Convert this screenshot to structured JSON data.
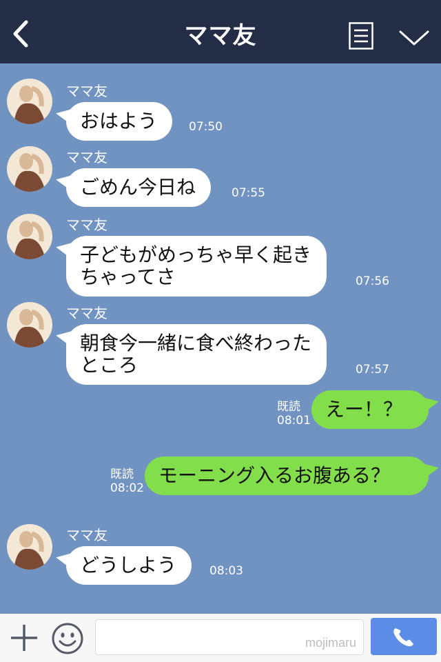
{
  "header": {
    "title": "ママ友",
    "back_icon": "chevron-left-icon",
    "menu_icon": "list-icon",
    "collapse_icon": "chevron-down-icon"
  },
  "messages": [
    {
      "sender": "ママ友",
      "text": "おはよう",
      "time": "07:50"
    },
    {
      "sender": "ママ友",
      "text": "ごめん今日ね",
      "time": "07:55"
    },
    {
      "sender": "ママ友",
      "line1": "子どもがめっちゃ早く起き",
      "line2": "ちゃってさ",
      "time": "07:56"
    },
    {
      "sender": "ママ友",
      "line1": "朝食今一緒に食べ終わった",
      "line2": "ところ",
      "time": "07:57"
    },
    {
      "read": "既読",
      "text": "えー！？",
      "time": "08:01"
    },
    {
      "read": "既読",
      "text": "モーニング入るお腹ある？",
      "time": "08:02"
    },
    {
      "sender": "ママ友",
      "text": "どうしよう",
      "time": "08:03"
    }
  ],
  "footer": {
    "watermark": "mojimaru",
    "plus_icon": "plus-icon",
    "emoji_icon": "smile-icon",
    "call_icon": "phone-icon"
  },
  "colors": {
    "header_bg": "#232d45",
    "chat_bg": "#7193c1",
    "out_bubble": "#82de4b",
    "call_button": "#5b8ce6"
  }
}
